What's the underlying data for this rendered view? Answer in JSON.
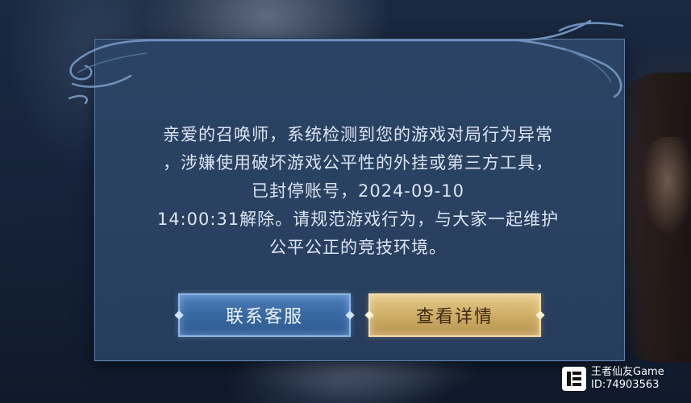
{
  "dialog": {
    "message_lines": [
      "亲爱的召唤师，系统检测到您的游戏对局行为异常",
      "，涉嫌使用破坏游戏公平性的外挂或第三方工具，",
      "已封停账号，2024-09-10",
      "14:00:31解除。请规范游戏行为，与大家一起维护",
      "公平公正的竞技环境。"
    ],
    "contact_button": "联系客服",
    "details_button": "查看详情"
  },
  "watermark": {
    "name": "王者仙友Game",
    "id": "ID:74903563"
  },
  "colors": {
    "dialog_bg": "#2a4161",
    "dialog_border": "#5d7ea6",
    "text": "#dbe4f2",
    "contact_button": "#3a6aa3",
    "details_button": "#cfae66"
  }
}
